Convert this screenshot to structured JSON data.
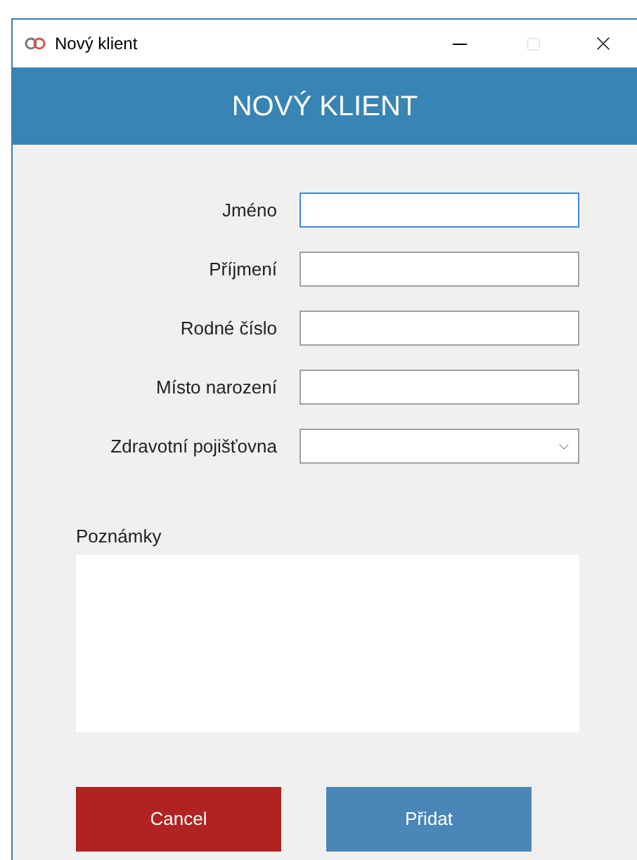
{
  "window": {
    "title": "Nový klient"
  },
  "header": "NOVÝ KLIENT",
  "fields": [
    {
      "label": "Jméno",
      "kind": "text",
      "focused": true
    },
    {
      "label": "Příjmení",
      "kind": "text",
      "focused": false
    },
    {
      "label": "Rodné číslo",
      "kind": "text",
      "focused": false
    },
    {
      "label": "Místo narození",
      "kind": "text",
      "focused": false
    },
    {
      "label": "Zdravotní pojišťovna",
      "kind": "select",
      "focused": false
    }
  ],
  "notes": {
    "label": "Poznámky"
  },
  "buttons": [
    {
      "label": "Cancel",
      "kind": "cancel"
    },
    {
      "label": "Přidat",
      "kind": "primary"
    }
  ]
}
